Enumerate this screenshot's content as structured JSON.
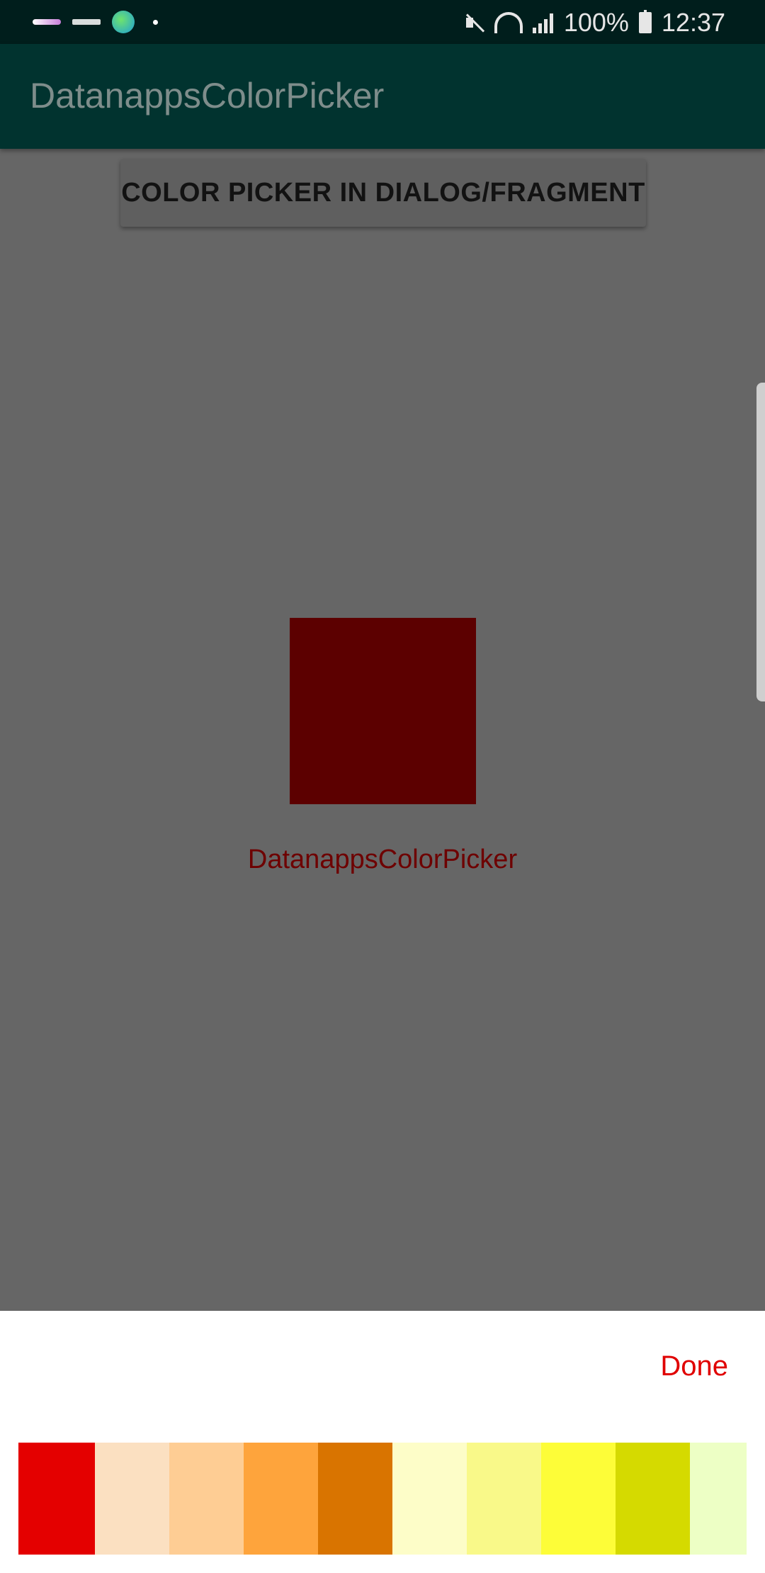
{
  "status_bar": {
    "battery": "100%",
    "time": "12:37",
    "icons": [
      "notification-icon",
      "notification-icon",
      "globe-icon",
      "dot-icon",
      "mute-icon",
      "wifi-icon",
      "signal-icon",
      "battery-icon"
    ]
  },
  "app_bar": {
    "title": "DatanappsColorPicker"
  },
  "main": {
    "button_label": "COLOR PICKER IN DIALOG/FRAGMENT",
    "preview_color": "#5c0000",
    "preview_label": "DatanappsColorPicker"
  },
  "bottom_sheet": {
    "done_label": "Done",
    "palette": [
      "#e40000",
      "#fbe0c1",
      "#fecd94",
      "#fea43c",
      "#d97400",
      "#fdfdc8",
      "#f9f989",
      "#fdfd38",
      "#d5da00",
      "#edffc5"
    ]
  }
}
